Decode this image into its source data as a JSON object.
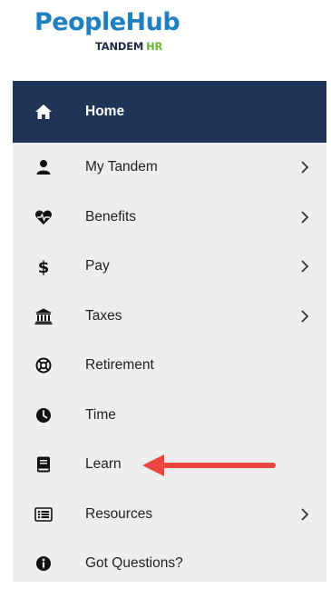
{
  "logo": {
    "main": "PeopleHub",
    "sub": "TANDEM",
    "sub_accent": "HR"
  },
  "menu": {
    "items": [
      {
        "id": "home",
        "label": "Home",
        "icon": "home-icon",
        "active": true,
        "has_submenu": false
      },
      {
        "id": "my-tandem",
        "label": "My Tandem",
        "icon": "user-icon",
        "active": false,
        "has_submenu": true
      },
      {
        "id": "benefits",
        "label": "Benefits",
        "icon": "heartbeat-icon",
        "active": false,
        "has_submenu": true
      },
      {
        "id": "pay",
        "label": "Pay",
        "icon": "dollar-icon",
        "active": false,
        "has_submenu": true
      },
      {
        "id": "taxes",
        "label": "Taxes",
        "icon": "bank-icon",
        "active": false,
        "has_submenu": true
      },
      {
        "id": "retirement",
        "label": "Retirement",
        "icon": "life-ring-icon",
        "active": false,
        "has_submenu": false
      },
      {
        "id": "time",
        "label": "Time",
        "icon": "clock-icon",
        "active": false,
        "has_submenu": false
      },
      {
        "id": "learn",
        "label": "Learn",
        "icon": "book-icon",
        "active": false,
        "has_submenu": false
      },
      {
        "id": "resources",
        "label": "Resources",
        "icon": "list-icon",
        "active": false,
        "has_submenu": true
      },
      {
        "id": "got-questions",
        "label": "Got Questions?",
        "icon": "info-icon",
        "active": false,
        "has_submenu": false
      }
    ]
  },
  "colors": {
    "brand_blue": "#1f7fc0",
    "active_bg": "#1f3558",
    "menu_bg": "#eeeeee",
    "accent_green": "#6bb33a",
    "annotation_red": "#e8473f"
  }
}
